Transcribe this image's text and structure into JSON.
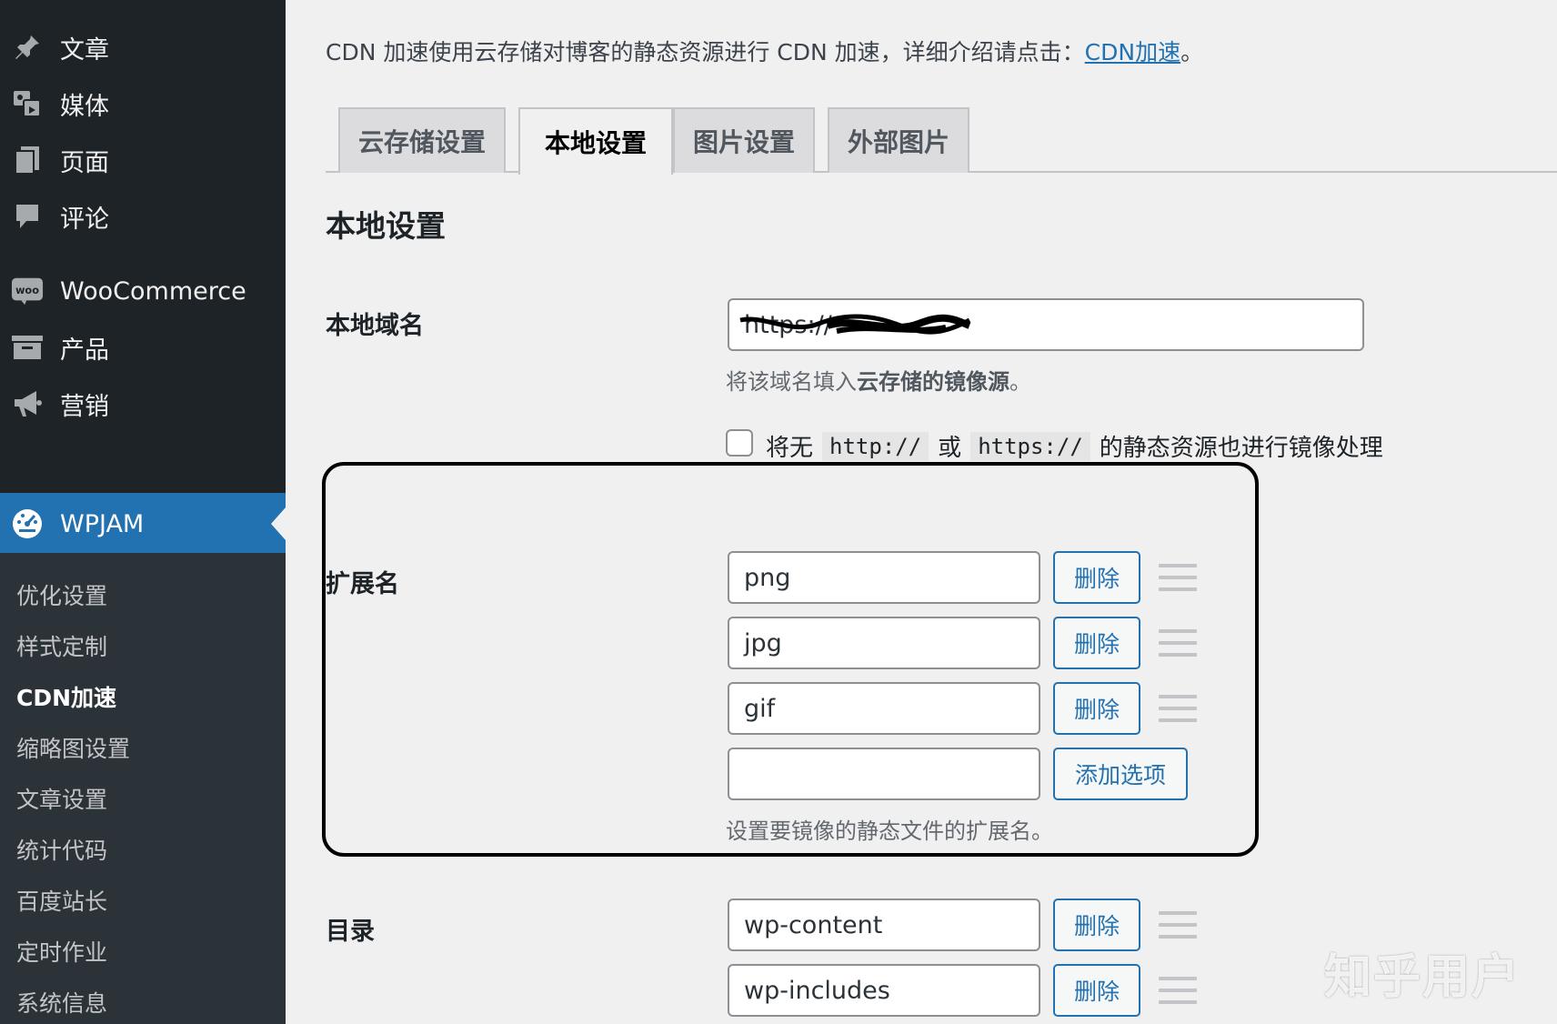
{
  "sidebar": {
    "menu": [
      {
        "label": "文章",
        "icon": "pin-icon"
      },
      {
        "label": "媒体",
        "icon": "media-icon"
      },
      {
        "label": "页面",
        "icon": "page-icon"
      },
      {
        "label": "评论",
        "icon": "comment-icon"
      },
      {
        "label": "WooCommerce",
        "icon": "woo-icon"
      },
      {
        "label": "产品",
        "icon": "archive-icon"
      },
      {
        "label": "营销",
        "icon": "megaphone-icon"
      },
      {
        "label": "WPJAM",
        "icon": "dashboard-icon",
        "active": true
      }
    ],
    "submenu": [
      {
        "label": "优化设置"
      },
      {
        "label": "样式定制"
      },
      {
        "label": "CDN加速",
        "current": true
      },
      {
        "label": "缩略图设置"
      },
      {
        "label": "文章设置"
      },
      {
        "label": "统计代码"
      },
      {
        "label": "百度站长"
      },
      {
        "label": "定时作业"
      },
      {
        "label": "系统信息"
      }
    ]
  },
  "intro": {
    "text": "CDN 加速使用云存储对博客的静态资源进行 CDN 加速，详细介绍请点击：",
    "link": "CDN加速",
    "suffix": "。"
  },
  "tabs": [
    {
      "label": "云存储设置"
    },
    {
      "label": "本地设置",
      "active": true
    },
    {
      "label": "图片设置"
    },
    {
      "label": "外部图片"
    }
  ],
  "section_title": "本地设置",
  "local_domain": {
    "label": "本地域名",
    "value": "https://",
    "desc_prefix": "将该域名填入",
    "desc_bold": "云存储的镜像源",
    "desc_suffix": "。"
  },
  "no_protocol": {
    "pre": "将无",
    "code1": "http://",
    "mid": "或",
    "code2": "https://",
    "post": "的静态资源也进行镜像处理",
    "checked": false
  },
  "extensions": {
    "label": "扩展名",
    "items": [
      "png",
      "jpg",
      "gif"
    ],
    "new_value": "",
    "delete_label": "删除",
    "add_label": "添加选项",
    "desc": "设置要镜像的静态文件的扩展名。"
  },
  "directories": {
    "label": "目录",
    "items": [
      "wp-content",
      "wp-includes"
    ],
    "delete_label": "删除"
  },
  "watermark": "知乎用户",
  "colors": {
    "sidebar_bg": "#1d2327",
    "submenu_bg": "#2c3338",
    "accent": "#2271b1",
    "page_bg": "#f0f0f1"
  }
}
